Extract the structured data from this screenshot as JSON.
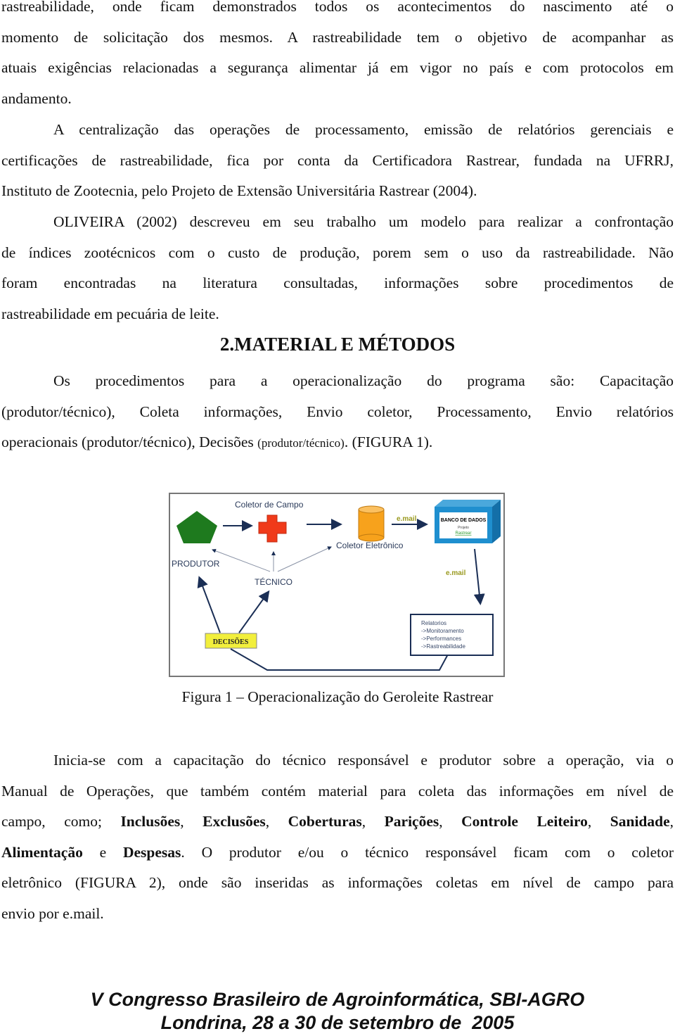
{
  "paragraph_1": {
    "lines": [
      "rastreabilidade, onde ficam demonstrados todos os acontecimentos do nascimento até o",
      "momento de solicitação dos mesmos. A rastreabilidade tem o objetivo de acompanhar as",
      "atuais exigências relacionadas a segurança alimentar já em vigor no país e com protocolos em",
      "andamento."
    ]
  },
  "paragraph_2": {
    "lines": [
      "A centralização das operações de processamento, emissão de relatórios gerenciais e",
      "certificações de rastreabilidade, fica por conta da Certificadora Rastrear, fundada na UFRRJ,",
      "Instituto de Zootecnia, pelo Projeto de Extensão Universitária Rastrear (2004)."
    ]
  },
  "paragraph_3": {
    "lines": [
      "OLIVEIRA (2002) descreveu em seu trabalho um modelo para realizar a confrontação",
      "de índices zootécnicos com o custo de produção, porem sem o uso da rastreabilidade. Não",
      "foram encontradas na literatura consultadas, informações sobre procedimentos de",
      "rastreabilidade em pecuária de leite."
    ]
  },
  "section_heading": "2.MATERIAL E MÉTODOS",
  "paragraph_4": {
    "lines": [
      "Os procedimentos para a operacionalização do programa são: Capacitação",
      "(produtor/técnico), Coleta informações, Envio coletor, Processamento, Envio relatórios"
    ],
    "line3_part1": "operacionais (produtor/técnico),  Decisões ",
    "line3_small": "(produtor/técnico)",
    "line3_part2": ". (FIGURA 1)."
  },
  "figure": {
    "colors": {
      "produtor": "#1e7a1e",
      "coletor_campo": "#f03a1a",
      "coletor_eletronico": "#f7a21c",
      "banco": "#1f8fcf",
      "arrow": "#1a2e55",
      "thin_arrow": "#8a93a6",
      "email": "#9a9a20",
      "decisoes_bg": "#f2ef3c"
    },
    "labels": {
      "coletor_campo": "Coletor de Campo",
      "coletor_eletronico": "Coletor Eletrônico",
      "produtor": "PRODUTOR",
      "tecnico": "TÉCNICO",
      "email_1": "e.mail",
      "email_2": "e.mail",
      "banco_title": "BANCO DE DADOS",
      "banco_sub1": "Projeto",
      "banco_sub2": "Rastrear",
      "decisoes": "DECISÕES",
      "relatorios": [
        "Relatorios",
        "->Monitoramento",
        "->Performances",
        "->Rastreabilidade"
      ]
    }
  },
  "caption": "Figura 1 – Operacionalização do Geroleite Rastrear",
  "paragraph_5": {
    "line1": "Inicia-se com a capacitação do técnico responsável e produtor sobre a operação, via o",
    "line2": "Manual de Operações, que também contém material para coleta das informações em nível de",
    "line3_intro": "campo, como; ",
    "items": [
      "Inclusões",
      "Exclusões",
      "Coberturas",
      "Parições",
      "Controle Leiteiro",
      "Sanidade",
      "Alimentação",
      "Despesas"
    ],
    "line4_rest": ". O produtor e/ou o técnico responsável ficam com o coletor",
    "line5": "eletrônico (FIGURA 2), onde são inseridas as informações coletas em nível de campo para",
    "line6": "envio por e.mail."
  },
  "footer": {
    "line1": "V Congresso Brasileiro de Agroinformática, SBI-AGRO",
    "line2": "Londrina, 28 a 30 de setembro de  2005"
  }
}
